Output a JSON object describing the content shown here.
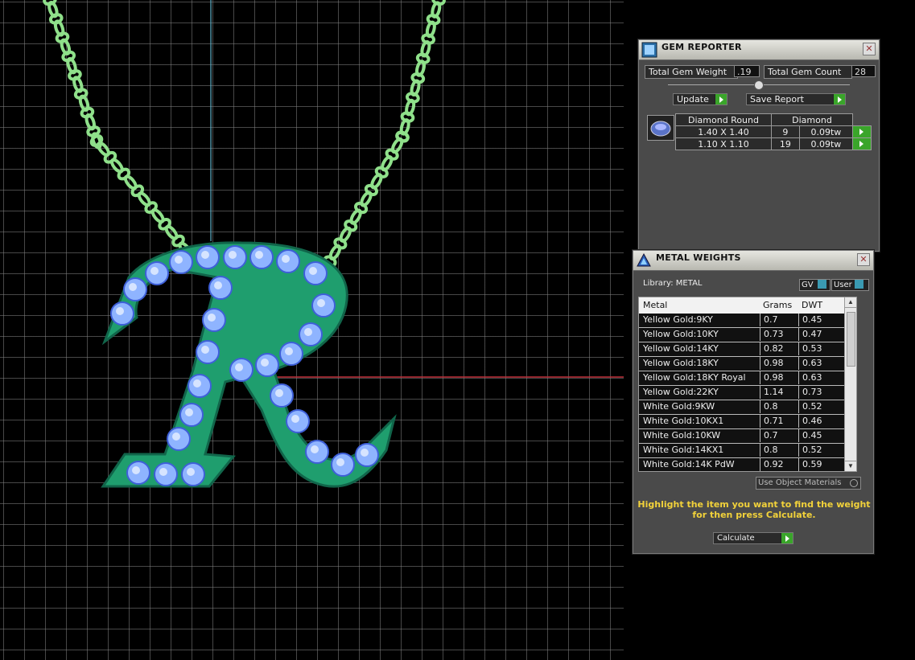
{
  "gem_reporter": {
    "title": "GEM REPORTER",
    "close": "✕",
    "total_weight_label": "Total Gem Weight",
    "total_weight_value": ".19",
    "total_count_label": "Total Gem Count",
    "total_count_value": "28",
    "update_label": "Update",
    "save_report_label": "Save Report",
    "table_headers": [
      "Diamond Round",
      "Diamond"
    ],
    "rows": [
      {
        "size": "1.40 X 1.40",
        "count": "9",
        "weight": "0.09tw"
      },
      {
        "size": "1.10 X 1.10",
        "count": "19",
        "weight": "0.09tw"
      }
    ]
  },
  "metal_weights": {
    "title": "METAL WEIGHTS",
    "close": "✕",
    "library_label": "Library: METAL",
    "gv_label": "GV",
    "user_label": "User",
    "headers": [
      "Metal",
      "Grams",
      "DWT"
    ],
    "rows": [
      {
        "metal": "Yellow Gold:9KY",
        "grams": "0.7",
        "dwt": "0.45"
      },
      {
        "metal": "Yellow Gold:10KY",
        "grams": "0.73",
        "dwt": "0.47"
      },
      {
        "metal": "Yellow Gold:14KY",
        "grams": "0.82",
        "dwt": "0.53"
      },
      {
        "metal": "Yellow Gold:18KY",
        "grams": "0.98",
        "dwt": "0.63"
      },
      {
        "metal": "Yellow Gold:18KY Royal",
        "grams": "0.98",
        "dwt": "0.63"
      },
      {
        "metal": "Yellow Gold:22KY",
        "grams": "1.14",
        "dwt": "0.73"
      },
      {
        "metal": "White Gold:9KW",
        "grams": "0.8",
        "dwt": "0.52"
      },
      {
        "metal": "White Gold:10KX1",
        "grams": "0.71",
        "dwt": "0.46"
      },
      {
        "metal": "White Gold:10KW",
        "grams": "0.7",
        "dwt": "0.45"
      },
      {
        "metal": "White Gold:14KX1",
        "grams": "0.8",
        "dwt": "0.52"
      },
      {
        "metal": "White Gold:14K PdW",
        "grams": "0.92",
        "dwt": "0.59"
      }
    ],
    "use_object_materials": "Use Object Materials",
    "hint_line1": "Highlight the item you want to find the weight",
    "hint_line2": "for then press Calculate.",
    "calculate_label": "Calculate"
  },
  "colors": {
    "pendant": "#1f9e6e",
    "chain": "#8fe08a",
    "gem": "#8fb4ff",
    "accent_green": "#3aa52a",
    "hint_yellow": "#f2d23a"
  }
}
